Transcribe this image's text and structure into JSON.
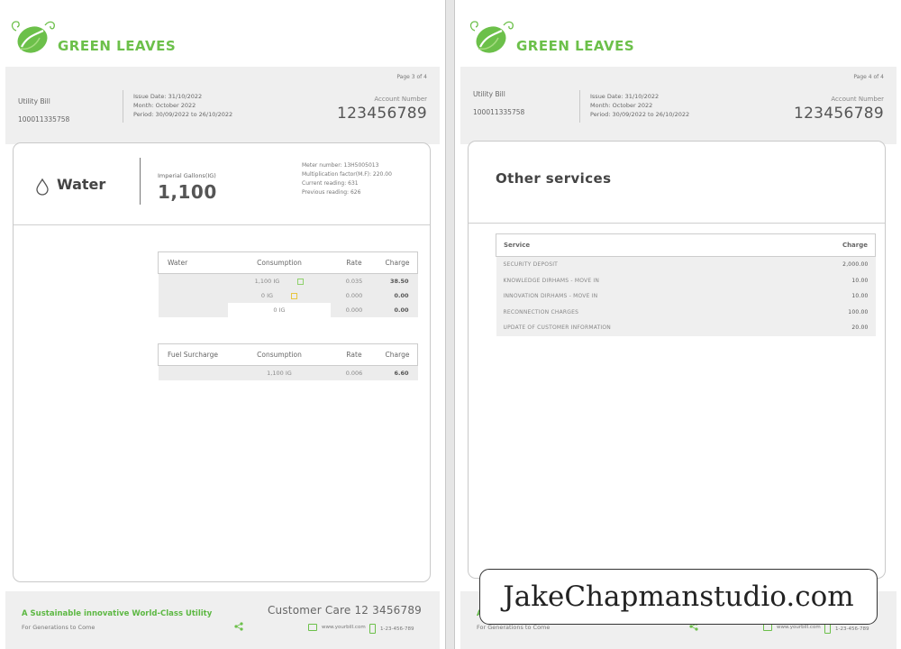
{
  "brand": {
    "name": "GREEN LEAVES",
    "accent": "#6cc04a"
  },
  "pages": [
    {
      "page_label": "Page 3 of 4",
      "doc_type": "Utility Bill",
      "account_number_small": "100011335758",
      "issue_date": "Issue Date: 31/10/2022",
      "month": "Month: October 2022",
      "period": "Period: 30/09/2022 to 26/10/2022",
      "account_label": "Account Number",
      "account_number": "123456789"
    },
    {
      "page_label": "Page 4 of 4",
      "doc_type": "Utility Bill",
      "account_number_small": "100011335758",
      "issue_date": "Issue Date: 31/10/2022",
      "month": "Month: October 2022",
      "period": "Period: 30/09/2022 to 26/10/2022",
      "account_label": "Account Number",
      "account_number": "123456789"
    }
  ],
  "water": {
    "title": "Water",
    "ig_label": "Imperial Gallons(IG)",
    "ig_value": "1,100",
    "meter_number": "Meter number: 13H5005013",
    "multiplication_factor": "Multiplication factor(M.F): 220.00",
    "current_reading": "Current reading: 631",
    "previous_reading": "Previous reading: 626",
    "table": {
      "headers": [
        "Water",
        "Consumption",
        "Rate",
        "Charge"
      ],
      "rows": [
        {
          "consumption": "1,100 IG",
          "rate": "0.035",
          "charge": "38.50",
          "marker": "#8fd16c"
        },
        {
          "consumption": "0 IG",
          "rate": "0.000",
          "charge": "0.00",
          "marker": "#e8c640"
        },
        {
          "consumption": "0 IG",
          "rate": "0.000",
          "charge": "0.00"
        }
      ]
    },
    "fuel_table": {
      "headers": [
        "Fuel Surcharge",
        "Consumption",
        "Rate",
        "Charge"
      ],
      "rows": [
        {
          "consumption": "1,100 IG",
          "rate": "0.006",
          "charge": "6.60"
        }
      ]
    }
  },
  "other_services": {
    "title": "Other services",
    "headers": [
      "Service",
      "Charge"
    ],
    "rows": [
      {
        "service": "SECURITY DEPOSIT",
        "charge": "2,000.00"
      },
      {
        "service": "KNOWLEDGE DIRHAMS - MOVE IN",
        "charge": "10.00"
      },
      {
        "service": "INNOVATION DIRHAMS - MOVE IN",
        "charge": "10.00"
      },
      {
        "service": "RECONNECTION CHARGES",
        "charge": "100.00"
      },
      {
        "service": "UPDATE OF CUSTOMER INFORMATION",
        "charge": "20.00"
      }
    ]
  },
  "footer": {
    "tagline": "A Sustainable innovative World-Class Utility",
    "sub": "For Generations to Come",
    "care": "Customer Care 12 3456789",
    "web": "www.yourbill.com",
    "phone": "1-23-456-789"
  },
  "watermark": "JakeChapmanstudio.com"
}
